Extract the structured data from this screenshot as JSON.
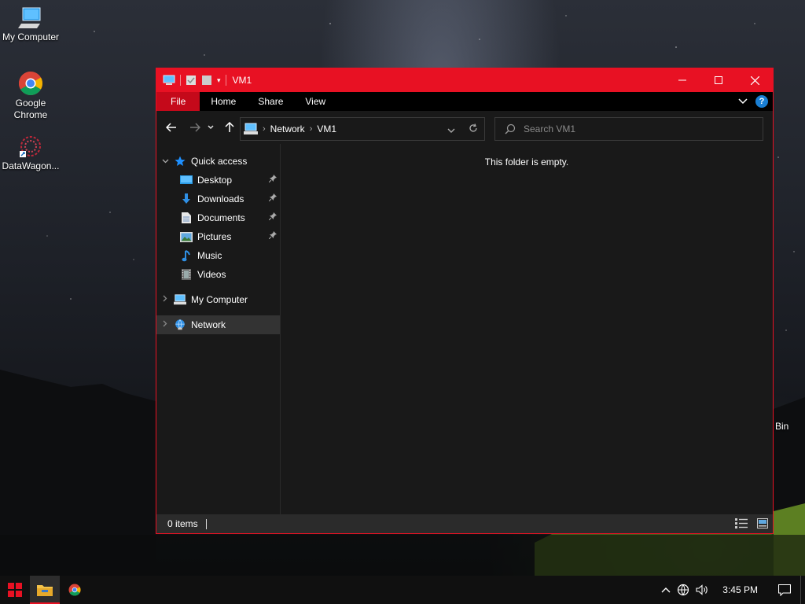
{
  "desktop": {
    "icons": [
      {
        "label": "My Computer"
      },
      {
        "label_line1": "Google",
        "label_line2": "Chrome"
      },
      {
        "label": "DataWagon..."
      }
    ],
    "recycle_bin_partial": "Bin"
  },
  "window": {
    "title": "VM1",
    "ribbon_tabs": [
      "File",
      "Home",
      "Share",
      "View"
    ],
    "help_label": "?",
    "address": {
      "crumbs": [
        "Network",
        "VM1"
      ]
    },
    "search": {
      "placeholder": "Search VM1"
    },
    "navpane": {
      "quick_access": "Quick access",
      "quick_items": [
        "Desktop",
        "Downloads",
        "Documents",
        "Pictures",
        "Music",
        "Videos"
      ],
      "my_computer": "My Computer",
      "network": "Network"
    },
    "content": {
      "empty_message": "This folder is empty."
    },
    "status": {
      "items_count": "0 items"
    }
  },
  "taskbar": {
    "clock": "3:45 PM"
  },
  "colors": {
    "accent": "#e81123",
    "file_tab": "#c5091a",
    "window_bg": "#191919"
  }
}
